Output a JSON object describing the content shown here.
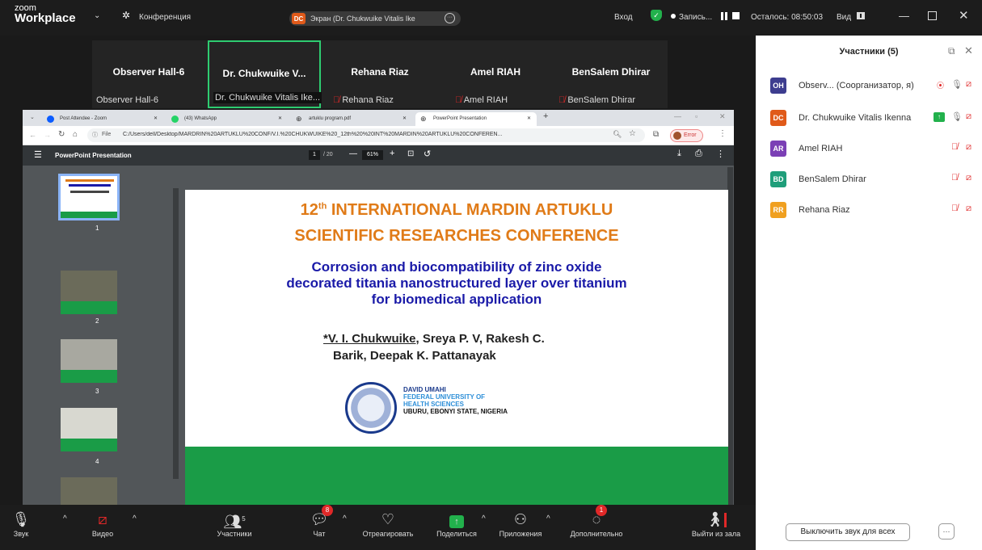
{
  "app": {
    "logo_small": "zoom",
    "logo_big": "Workplace",
    "conference_label": "Конференция"
  },
  "share_pill": {
    "avatar": "DC",
    "label": "Экран (Dr. Chukwuike Vitalis Ike"
  },
  "topbar": {
    "login": "Вход",
    "record": "Запись...",
    "remaining": "Осталось: 08:50:03",
    "view": "Вид"
  },
  "thumbnails": [
    {
      "name": "Observer  Hall-6",
      "label": "Observer  Hall-6",
      "muted": false
    },
    {
      "name": "Dr. Chukwuike V...",
      "label": "Dr. Chukwuike Vitalis Ike...",
      "muted": false,
      "active": true
    },
    {
      "name": "Rehana Riaz",
      "label": "Rehana Riaz",
      "muted": true
    },
    {
      "name": "Amel RIAH",
      "label": "Amel RIAH",
      "muted": true
    },
    {
      "name": "BenSalem Dhirar",
      "label": "BenSalem Dhirar",
      "muted": true
    }
  ],
  "browser": {
    "tabs": [
      "Post Attendee - Zoom",
      "(43) WhatsApp",
      "artuklu program.pdf",
      "PowerPoint Presentation"
    ],
    "address": "C:/Users/dell/Desktop/MARDRIN%20ARTUKLU%20CONF/V.I.%20CHUKWUIKE%20_12th%20%20INT%20MARDIN%20ARTUKLU%20CONFEREN...",
    "file_label": "File",
    "error": "Error",
    "pdf_title": "PowerPoint Presentation",
    "page_current": "1",
    "page_total": "/ 20",
    "zoom": "61%",
    "thumb_pages": [
      "1",
      "2",
      "3",
      "4"
    ]
  },
  "slide": {
    "edition": "12",
    "edition_sup": "th",
    "title_line1": " INTERNATIONAL MARDIN ARTUKLU",
    "title_line2": "SCIENTIFIC RESEARCHES CONFERENCE",
    "paper_line1": "Corrosion and biocompatibility of zinc oxide",
    "paper_line2": "decorated titania nanostructured layer over titanium",
    "paper_line3": "for biomedical application",
    "author_main": "*V. I. Chukwuike",
    "authors_rest": ", Sreya P. V, Rakesh C.",
    "authors_line2": "Barik, Deepak K. Pattanayak",
    "uni_line1": "DAVID UMAHI",
    "uni_line2": "FEDERAL UNIVERSITY OF",
    "uni_line3": "HEALTH SCIENCES",
    "uni_line4": "UBURU, EBONYI STATE, NIGERIA"
  },
  "bottombar": {
    "audio": "Звук",
    "video": "Видео",
    "participants": "Участники",
    "participants_count": "5",
    "chat": "Чат",
    "chat_badge": "8",
    "react": "Отреагировать",
    "share": "Поделиться",
    "apps": "Приложения",
    "more": "Дополнительно",
    "more_badge": "1",
    "leave": "Выйти из зала"
  },
  "panel": {
    "title": "Участники (5)",
    "participants": [
      {
        "initials": "OH",
        "color": "#3d3d8f",
        "name": "Observ...  (Соорганизатор, я)"
      },
      {
        "initials": "DC",
        "color": "#e05a1a",
        "name": "Dr. Chukwuike Vitalis Ikenna"
      },
      {
        "initials": "AR",
        "color": "#7b3fb5",
        "name": "Amel RIAH"
      },
      {
        "initials": "BD",
        "color": "#1f9e7a",
        "name": "BenSalem Dhirar"
      },
      {
        "initials": "RR",
        "color": "#f0a020",
        "name": "Rehana Riaz"
      }
    ],
    "mute_all": "Выключить звук для всех",
    "more_btn": "···"
  },
  "colors": {
    "accent": "#0b5cff",
    "slide_orange": "#e07b18",
    "slide_blue": "#1a1aa8",
    "slide_green": "#1a9c47",
    "active_border": "#2ecc71"
  }
}
